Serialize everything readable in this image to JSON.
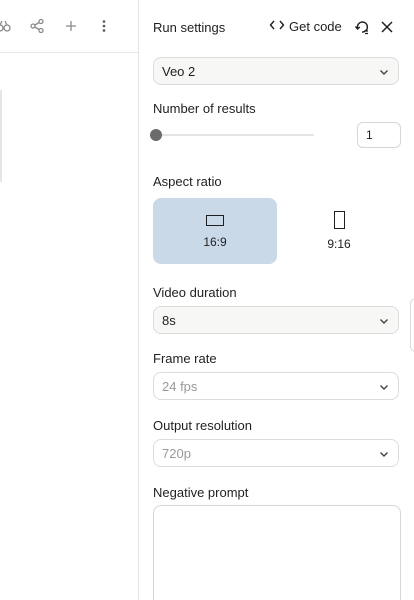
{
  "left_toolbar": {
    "icons": [
      "compare-icon",
      "share-icon",
      "add-icon",
      "more-vert-icon"
    ]
  },
  "header": {
    "title": "Run settings",
    "get_code_label": "Get code",
    "reset_icon": "reset-icon",
    "close_icon": "close-icon"
  },
  "model": {
    "selected": "Veo 2"
  },
  "number_of_results": {
    "label": "Number of results",
    "value": "1",
    "slider_fraction": 0
  },
  "aspect_ratio": {
    "label": "Aspect ratio",
    "options": [
      {
        "label": "16:9",
        "selected": true
      },
      {
        "label": "9:16",
        "selected": false
      }
    ]
  },
  "video_duration": {
    "label": "Video duration",
    "selected": "8s"
  },
  "frame_rate": {
    "label": "Frame rate",
    "selected": "24 fps"
  },
  "output_resolution": {
    "label": "Output resolution",
    "selected": "720p"
  },
  "negative_prompt": {
    "label": "Negative prompt",
    "value": ""
  },
  "colors": {
    "selected_card": "#c9d9e8",
    "border": "#dcdcdc",
    "muted_text": "#9a9a9a"
  }
}
